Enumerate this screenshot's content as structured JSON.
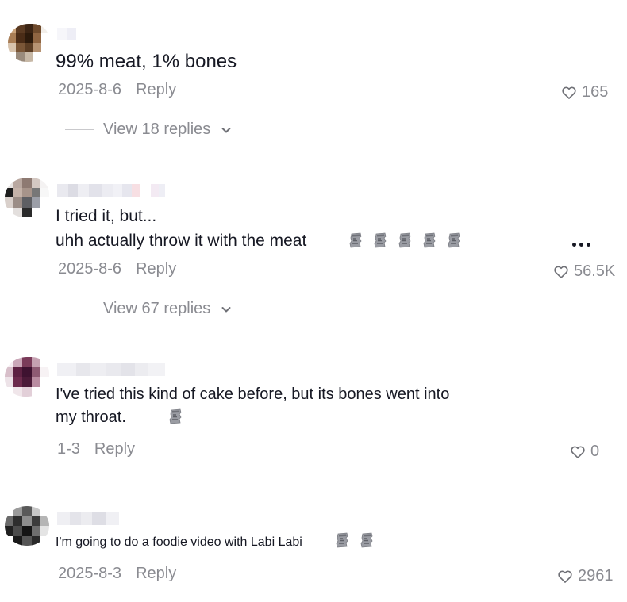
{
  "comments": [
    {
      "text": "99% meat, 1% bones",
      "date": "2025-8-6",
      "reply_label": "Reply",
      "likes": "165",
      "view_replies": "View 18 replies"
    },
    {
      "text_line1": "I tried it, but...",
      "text_line2": "uhh actually throw it with the meat",
      "date": "2025-8-6",
      "reply_label": "Reply",
      "likes": "56.5K",
      "view_replies": "View 67 replies"
    },
    {
      "text_line1": "I've tried this kind of cake before, but its bones went into",
      "text_line2": "my throat.",
      "date": "1-3",
      "reply_label": "Reply",
      "likes": "0"
    },
    {
      "text": "I'm going to do a foodie video with Labi Labi",
      "date": "2025-8-3",
      "reply_label": "Reply",
      "likes": "2961"
    }
  ],
  "icons": {
    "like": "heart-outline-icon",
    "expand": "chevron-down-icon",
    "more": "more-options-icon",
    "emoji": "moai-emoji"
  },
  "colors": {
    "text": "#161823",
    "secondary": "#8a8b91",
    "divider": "#c9c9cc"
  }
}
